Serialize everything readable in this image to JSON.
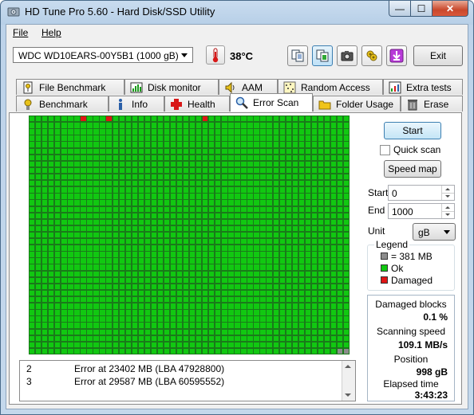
{
  "window": {
    "title": "HD Tune Pro 5.60 - Hard Disk/SSD Utility",
    "controls": {
      "minimize": "—",
      "maximize": "☐",
      "close": "✕"
    }
  },
  "menu": [
    "File",
    "Help"
  ],
  "toolbar": {
    "drive": "WDC WD10EARS-00Y5B1 (1000 gB)",
    "temperature": "38°C",
    "exit_label": "Exit",
    "icons": [
      "copy-text-icon",
      "copy-info-icon",
      "screenshot-camera-icon",
      "options-icon",
      "save-download-icon"
    ]
  },
  "tabs_back": [
    {
      "label": "File Benchmark",
      "icon": "file-benchmark-icon"
    },
    {
      "label": "Disk monitor",
      "icon": "disk-monitor-icon"
    },
    {
      "label": "AAM",
      "icon": "speaker-icon"
    },
    {
      "label": "Random Access",
      "icon": "random-access-icon"
    },
    {
      "label": "Extra tests",
      "icon": "extra-tests-icon"
    }
  ],
  "tabs_front": [
    {
      "label": "Benchmark",
      "icon": "benchmark-icon"
    },
    {
      "label": "Info",
      "icon": "info-icon"
    },
    {
      "label": "Health",
      "icon": "health-cross-icon"
    },
    {
      "label": "Error Scan",
      "icon": "magnifier-icon",
      "active": true
    },
    {
      "label": "Folder Usage",
      "icon": "folder-icon"
    },
    {
      "label": "Erase",
      "icon": "trash-icon"
    }
  ],
  "scan_grid": {
    "columns": 50,
    "rows": 37,
    "damaged_blocks": [
      [
        0,
        8
      ],
      [
        0,
        12
      ],
      [
        0,
        27
      ]
    ],
    "unscanned_blocks": [
      [
        36,
        48
      ],
      [
        36,
        49
      ]
    ],
    "colors": {
      "ok": "#11c811",
      "damaged": "#e01515",
      "unscanned": "#8c8c8c"
    }
  },
  "log": [
    {
      "num": "2",
      "text": "Error at 23402 MB (LBA 47928800)"
    },
    {
      "num": "3",
      "text": "Error at 29587 MB (LBA 60595552)"
    }
  ],
  "controls": {
    "start_button": "Start",
    "quick_scan_label": "Quick scan",
    "quick_scan_checked": false,
    "speed_map_button": "Speed map",
    "start_label": "Start",
    "start_value": "0",
    "end_label": "End",
    "end_value": "1000",
    "unit_label": "Unit",
    "unit_value": "gB"
  },
  "legend": {
    "title": "Legend",
    "items": [
      {
        "label": "= 381 MB",
        "color": "#8c8c8c"
      },
      {
        "label": "Ok",
        "color": "#11c811"
      },
      {
        "label": "Damaged",
        "color": "#e01515"
      }
    ]
  },
  "stats": {
    "damaged_blocks_label": "Damaged blocks",
    "damaged_blocks_value": "0.1 %",
    "scanning_speed_label": "Scanning speed",
    "scanning_speed_value": "109.1 MB/s",
    "position_label": "Position",
    "position_value": "998 gB",
    "elapsed_label": "Elapsed time",
    "elapsed_value": "3:43:23"
  }
}
